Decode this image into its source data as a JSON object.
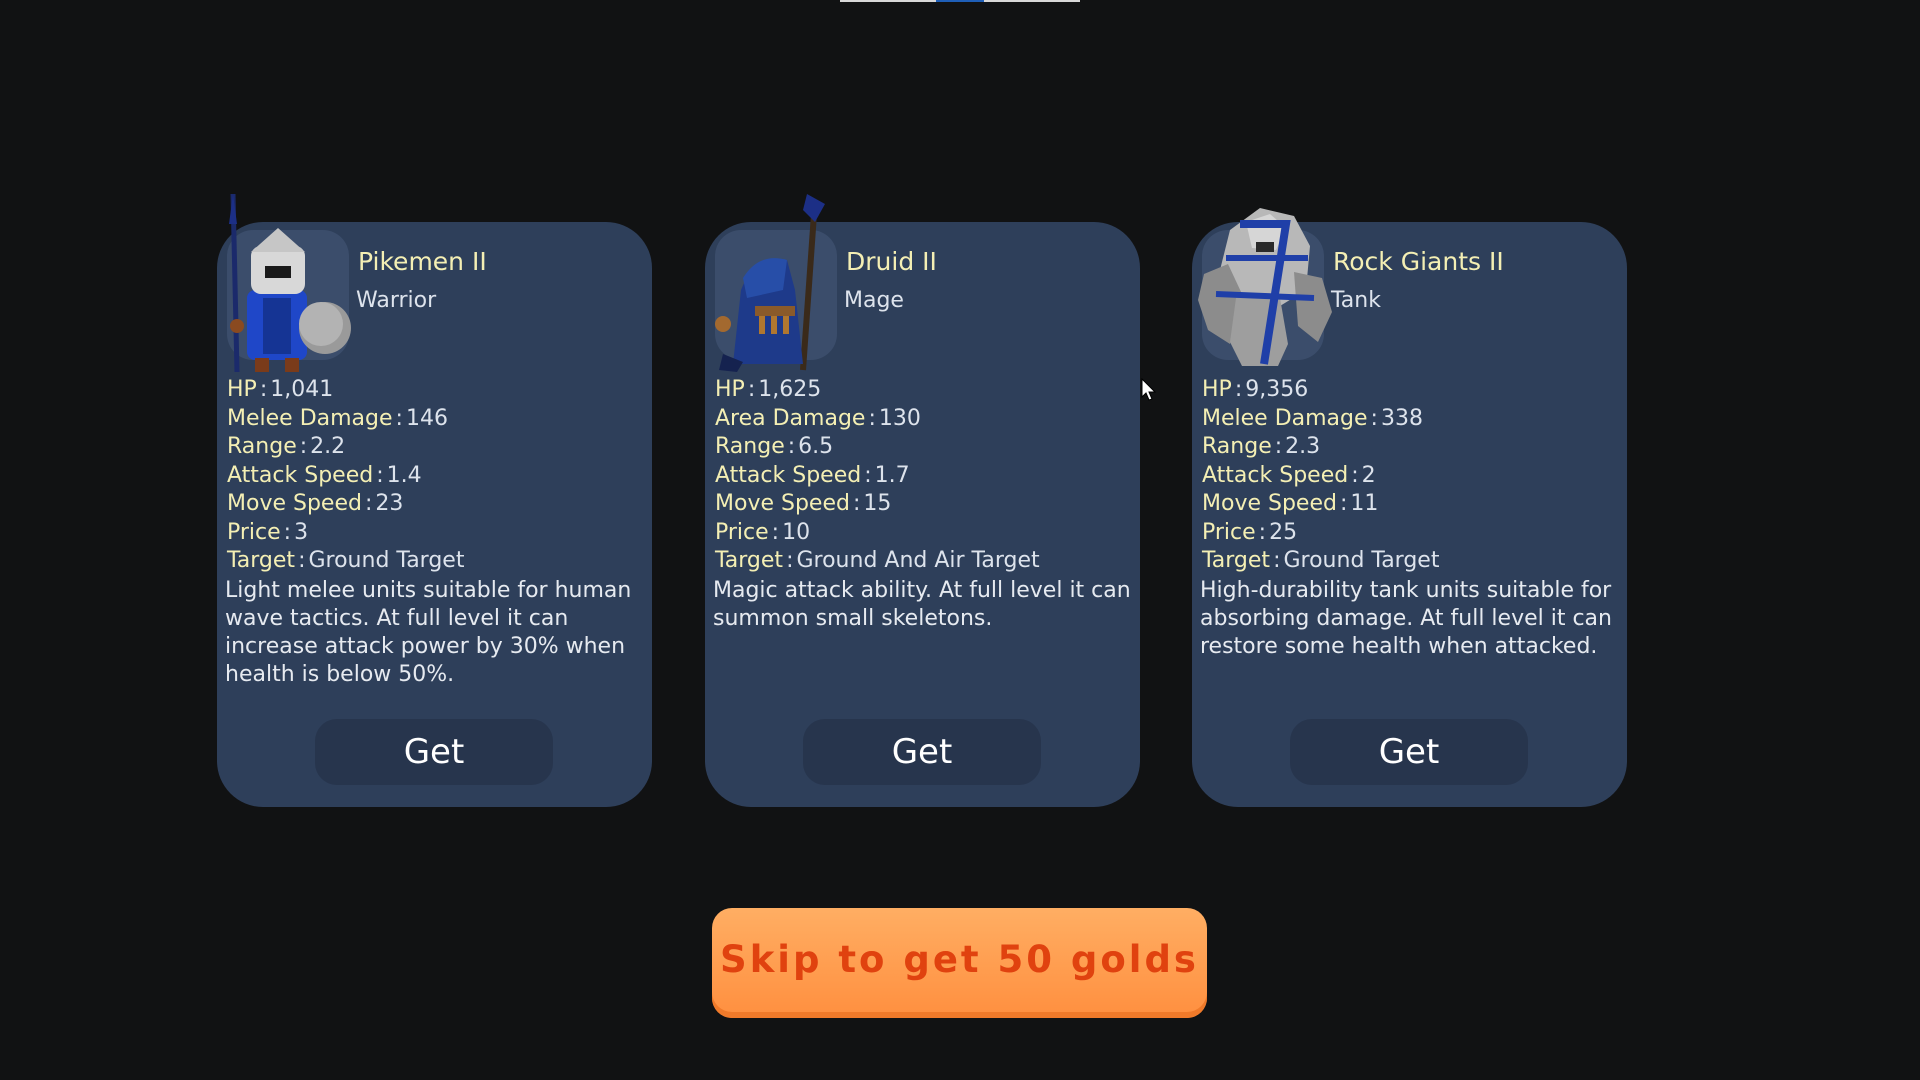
{
  "cards": [
    {
      "name": "Pikemen II",
      "role": "Warrior",
      "stats": [
        {
          "label": "HP",
          "value": "1,041"
        },
        {
          "label": "Melee Damage",
          "value": "146"
        },
        {
          "label": "Range",
          "value": "2.2"
        },
        {
          "label": "Attack Speed",
          "value": "1.4"
        },
        {
          "label": "Move Speed",
          "value": "23"
        },
        {
          "label": "Price",
          "value": "3"
        },
        {
          "label": "Target",
          "value": "Ground Target"
        }
      ],
      "description": "Light melee units suitable for human wave tactics. At full level it can increase attack power by 30% when health is below 50%.",
      "button": "Get"
    },
    {
      "name": "Druid II",
      "role": "Mage",
      "stats": [
        {
          "label": "HP",
          "value": "1,625"
        },
        {
          "label": "Area Damage",
          "value": "130"
        },
        {
          "label": "Range",
          "value": "6.5"
        },
        {
          "label": "Attack Speed",
          "value": "1.7"
        },
        {
          "label": "Move Speed",
          "value": "15"
        },
        {
          "label": "Price",
          "value": "10"
        },
        {
          "label": "Target",
          "value": "Ground And Air Target"
        }
      ],
      "description": "Magic attack ability. At full level it can summon small skeletons.",
      "button": "Get"
    },
    {
      "name": "Rock Giants II",
      "role": "Tank",
      "stats": [
        {
          "label": "HP",
          "value": "9,356"
        },
        {
          "label": "Melee Damage",
          "value": "338"
        },
        {
          "label": "Range",
          "value": "2.3"
        },
        {
          "label": "Attack Speed",
          "value": "2"
        },
        {
          "label": "Move Speed",
          "value": "11"
        },
        {
          "label": "Price",
          "value": "25"
        },
        {
          "label": "Target",
          "value": "Ground Target"
        }
      ],
      "description": "High-durability tank units suitable for absorbing damage. At full level it can restore some health when attacked.",
      "button": "Get"
    }
  ],
  "skip_button": "Skip to get 50 golds",
  "stat_separator": ":",
  "colors": {
    "background": "#111213",
    "card": "#2e3f5a",
    "stat_label": "#f4efb4",
    "skip_button": "#ff9a4a",
    "skip_text": "#e0420f"
  },
  "icons": [
    "pikeman-portrait-icon",
    "druid-portrait-icon",
    "rock-giant-portrait-icon",
    "mouse-cursor-icon"
  ]
}
